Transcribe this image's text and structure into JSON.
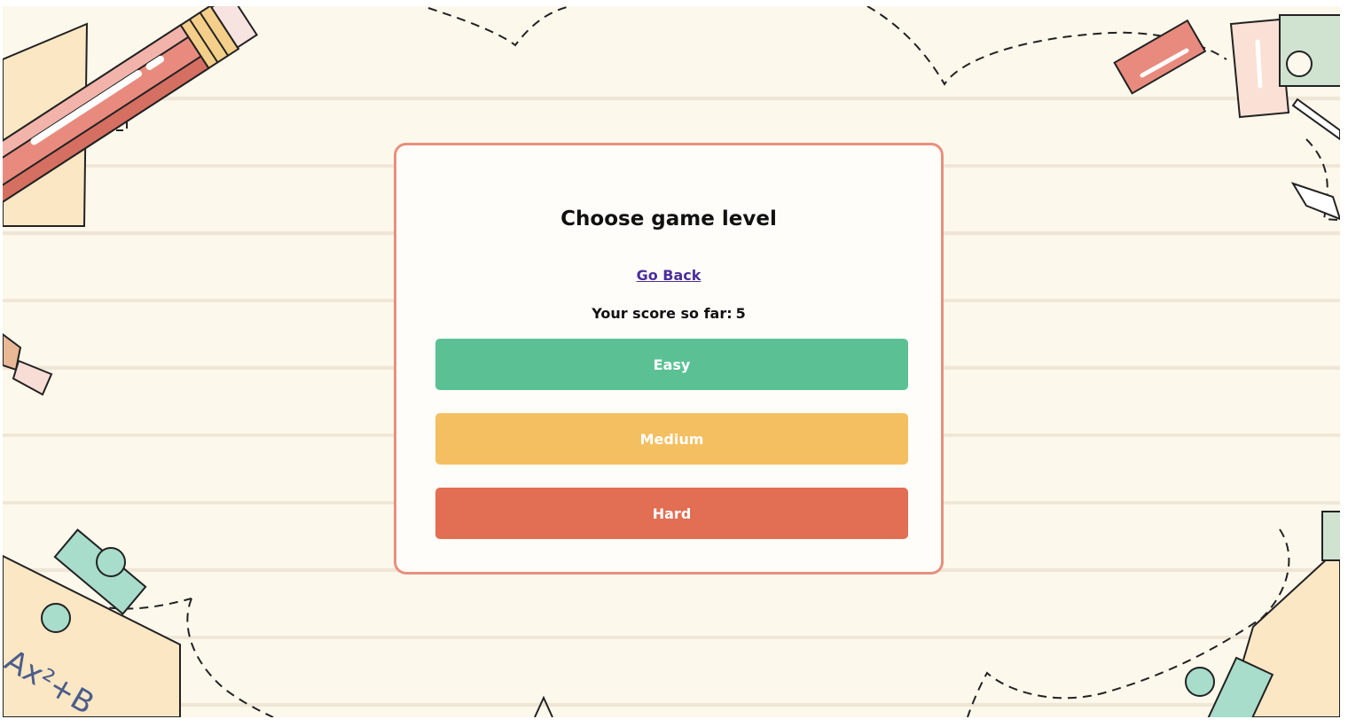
{
  "level_card": {
    "title": "Choose game level",
    "back_link": "Go Back",
    "score_label": "Your score so far:",
    "score_value": "5"
  },
  "levels": [
    {
      "label": "Easy",
      "color": "#5bc194"
    },
    {
      "label": "Medium",
      "color": "#f4bf60"
    },
    {
      "label": "Hard",
      "color": "#e26e53"
    }
  ],
  "decorations": {
    "formula_text": "Ax²+B",
    "icons": [
      "pencil-icon",
      "paper-sheet-icon",
      "eraser-icon",
      "pushpin-icon",
      "ruler-icon",
      "compass-icon"
    ]
  },
  "theme": {
    "paper": "#fdf8ec",
    "card_border": "#e7907f",
    "link": "#4a2f9a"
  }
}
